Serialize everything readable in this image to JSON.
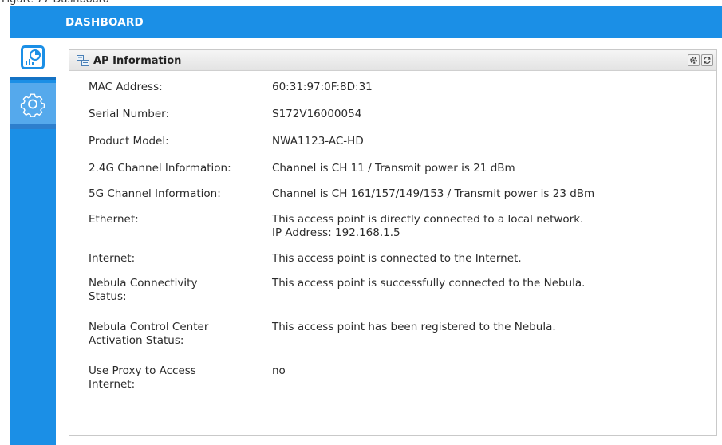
{
  "figure_caption": "Figure 77   Dashboard",
  "header": {
    "title": "DASHBOARD"
  },
  "sidebar": {
    "items": [
      {
        "name": "dashboard",
        "icon": "dashboard-chart-icon",
        "active": true
      },
      {
        "name": "settings",
        "icon": "gear-icon",
        "active": false
      }
    ]
  },
  "panel": {
    "title": "AP Information",
    "header_icon": "ap-info-icon",
    "buttons": [
      {
        "icon": "settings-icon"
      },
      {
        "icon": "refresh-icon"
      }
    ]
  },
  "rows": [
    {
      "label": "MAC Address:",
      "value": "60:31:97:0F:8D:31"
    },
    {
      "label": "Serial Number:",
      "value": "S172V16000054"
    },
    {
      "label": "Product Model:",
      "value": "NWA1123-AC-HD"
    },
    {
      "label": "2.4G Channel Information:",
      "value": "Channel is CH 11 / Transmit power is 21 dBm"
    },
    {
      "label": "5G Channel Information:",
      "value": "Channel is CH 161/157/149/153 / Transmit power is 23 dBm"
    },
    {
      "label": "Ethernet:",
      "value": "This access point is directly connected to a local network.",
      "value2": "IP Address: 192.168.1.5"
    },
    {
      "label": "Internet:",
      "value": "This access point is connected to the Internet."
    },
    {
      "label": "Nebula Connectivity",
      "label2": "Status:",
      "value": "This access point is successfully connected to the Nebula."
    },
    {
      "label": "Nebula Control Center",
      "label2": "Activation Status:",
      "value": "This access point has been registered to the Nebula."
    },
    {
      "label": "Use Proxy to Access",
      "label2": "Internet:",
      "value": "no"
    }
  ],
  "colors": {
    "brand_blue": "#1b8fe6",
    "settings_tab": "#55a9ec"
  }
}
